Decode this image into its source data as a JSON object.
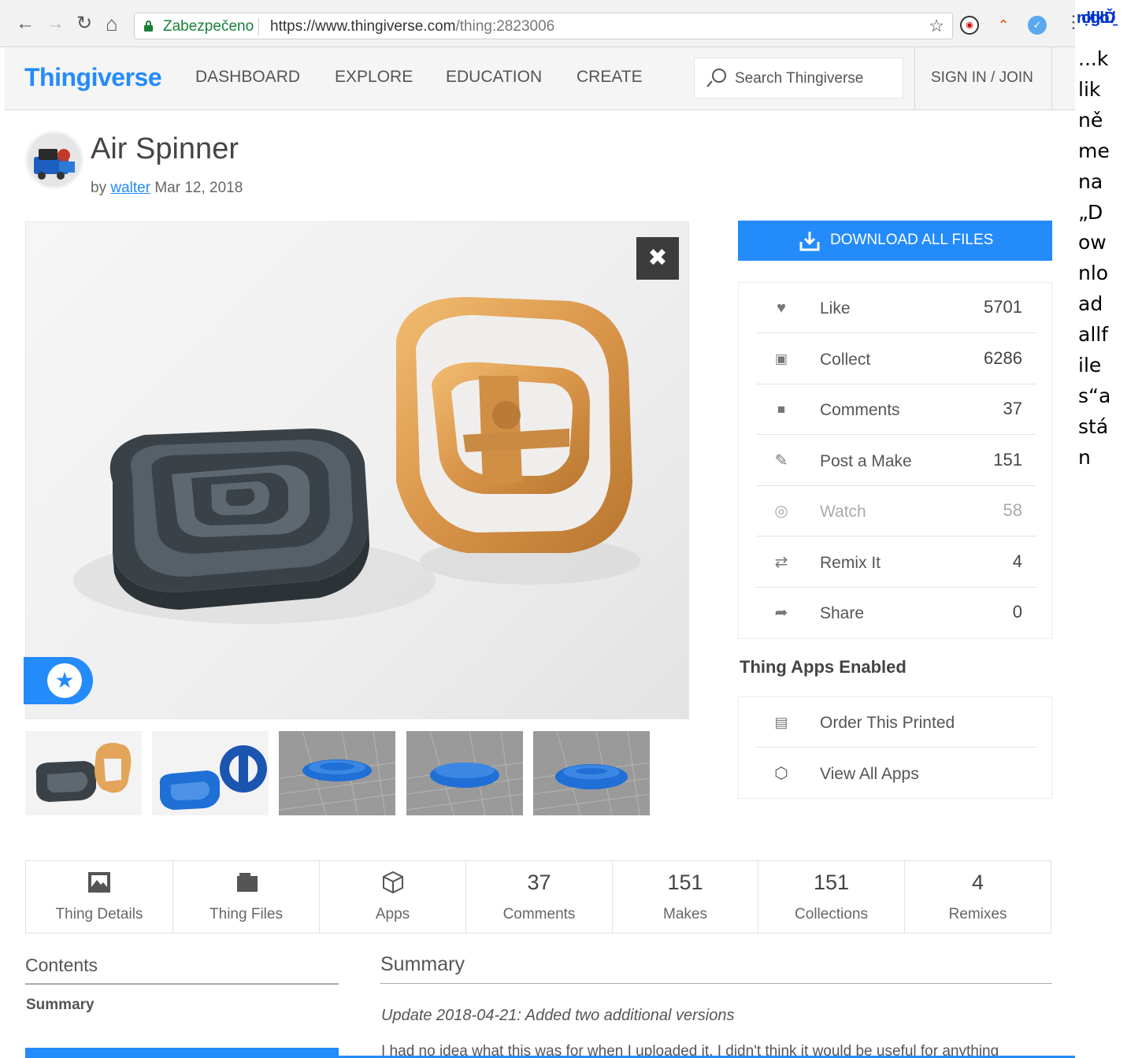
{
  "browser": {
    "secure_label": "Zabezpečeno",
    "url_host": "https://www.thingiverse.com",
    "url_path": "/thing:2823006",
    "gutter_garble": "nọktịtigkb Ď/̱",
    "gutter_text": "...klikněmena„Downloadallfiles“astán"
  },
  "header": {
    "logo": "Thingiverse",
    "nav": [
      "DASHBOARD",
      "EXPLORE",
      "EDUCATION",
      "CREATE"
    ],
    "search_placeholder": "Search Thingiverse",
    "signin": "SIGN IN / JOIN"
  },
  "thing": {
    "title": "Air Spinner",
    "by": "by",
    "author": "walter",
    "date": "Mar 12, 2018"
  },
  "download_label": "DOWNLOAD ALL FILES",
  "actions": [
    {
      "label": "Like",
      "count": "5701",
      "icon": "heart-icon"
    },
    {
      "label": "Collect",
      "count": "6286",
      "icon": "collect-icon"
    },
    {
      "label": "Comments",
      "count": "37",
      "icon": "comments-icon"
    },
    {
      "label": "Post a Make",
      "count": "151",
      "icon": "post-make-icon"
    },
    {
      "label": "Watch",
      "count": "58",
      "icon": "eye-icon"
    },
    {
      "label": "Remix It",
      "count": "4",
      "icon": "remix-icon"
    },
    {
      "label": "Share",
      "count": "0",
      "icon": "share-icon"
    }
  ],
  "apps": {
    "heading": "Thing Apps Enabled",
    "items": [
      {
        "label": "Order This Printed",
        "icon": "printer-icon"
      },
      {
        "label": "View All Apps",
        "icon": "cube-icon"
      }
    ]
  },
  "stats": [
    {
      "label": "Thing Details",
      "icon": "details-icon"
    },
    {
      "label": "Thing Files",
      "icon": "files-icon"
    },
    {
      "label": "Apps",
      "icon": "cube-icon"
    },
    {
      "label": "Comments",
      "value": "37"
    },
    {
      "label": "Makes",
      "value": "151"
    },
    {
      "label": "Collections",
      "value": "151"
    },
    {
      "label": "Remixes",
      "value": "4"
    }
  ],
  "contents": {
    "title": "Contents",
    "item": "Summary"
  },
  "summary": {
    "title": "Summary",
    "update": "Update 2018-04-21: Added two additional versions",
    "body": "I had no idea what this was for when I uploaded it. I didn't think it would be useful for anything"
  },
  "colors": {
    "brand_blue": "#248bfb",
    "secure_green": "#188038"
  }
}
